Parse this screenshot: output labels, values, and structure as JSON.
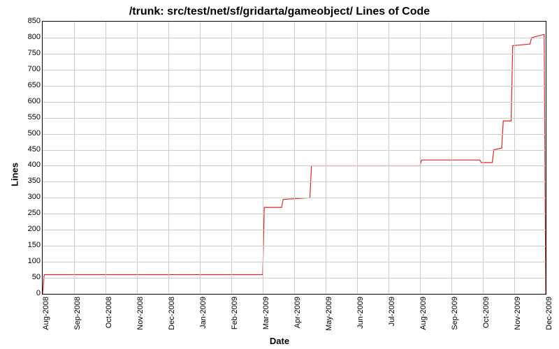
{
  "chart_data": {
    "type": "line",
    "title": "/trunk: src/test/net/sf/gridarta/gameobject/ Lines of Code",
    "xlabel": "Date",
    "ylabel": "Lines",
    "ylim": [
      0,
      850
    ],
    "yticks": [
      0,
      50,
      100,
      150,
      200,
      250,
      300,
      350,
      400,
      450,
      500,
      550,
      600,
      650,
      700,
      750,
      800,
      850
    ],
    "x_categories": [
      "Aug-2008",
      "Sep-2008",
      "Oct-2008",
      "Nov-2008",
      "Dec-2008",
      "Jan-2009",
      "Feb-2009",
      "Mar-2009",
      "Apr-2009",
      "May-2009",
      "Jun-2009",
      "Jul-2009",
      "Aug-2009",
      "Sep-2009",
      "Oct-2009",
      "Nov-2009",
      "Dec-2009"
    ],
    "series": [
      {
        "name": "Lines of Code",
        "color": "#d62728",
        "points": [
          {
            "x": 0.0,
            "y": 0
          },
          {
            "x": 0.05,
            "y": 60
          },
          {
            "x": 7.0,
            "y": 60
          },
          {
            "x": 7.05,
            "y": 270
          },
          {
            "x": 7.6,
            "y": 270
          },
          {
            "x": 7.65,
            "y": 295
          },
          {
            "x": 8.5,
            "y": 300
          },
          {
            "x": 8.55,
            "y": 400
          },
          {
            "x": 12.0,
            "y": 400
          },
          {
            "x": 12.05,
            "y": 418
          },
          {
            "x": 13.9,
            "y": 418
          },
          {
            "x": 13.95,
            "y": 410
          },
          {
            "x": 14.3,
            "y": 410
          },
          {
            "x": 14.35,
            "y": 450
          },
          {
            "x": 14.6,
            "y": 455
          },
          {
            "x": 14.65,
            "y": 540
          },
          {
            "x": 14.9,
            "y": 540
          },
          {
            "x": 14.95,
            "y": 775
          },
          {
            "x": 15.5,
            "y": 780
          },
          {
            "x": 15.55,
            "y": 800
          },
          {
            "x": 15.95,
            "y": 810
          },
          {
            "x": 16.0,
            "y": 0
          }
        ]
      }
    ]
  }
}
